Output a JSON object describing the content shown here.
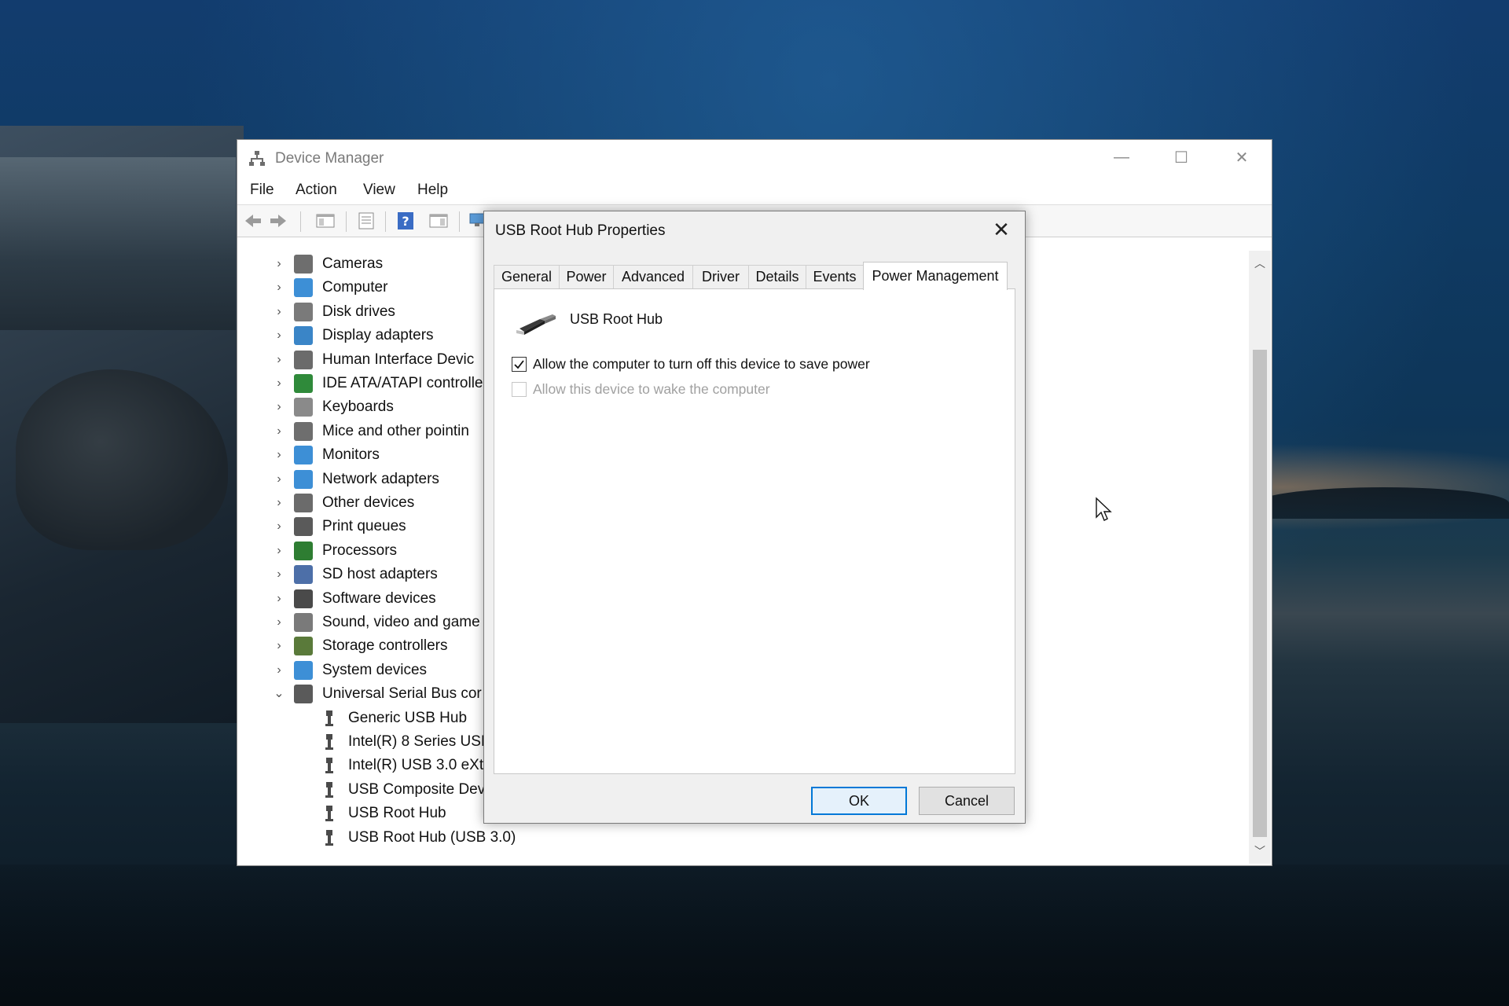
{
  "window": {
    "title": "Device Manager",
    "controls": {
      "minimize": "—",
      "maximize": "☐",
      "close": "✕"
    }
  },
  "menu": [
    "File",
    "Action",
    "View",
    "Help"
  ],
  "tree": {
    "categories": [
      "Cameras",
      "Computer",
      "Disk drives",
      "Display adapters",
      "Human Interface Devic",
      "IDE ATA/ATAPI controlle",
      "Keyboards",
      "Mice and other pointin",
      "Monitors",
      "Network adapters",
      "Other devices",
      "Print queues",
      "Processors",
      "SD host adapters",
      "Software devices",
      "Sound, video and game",
      "Storage controllers",
      "System devices",
      "Universal Serial Bus cor"
    ],
    "usb_children": [
      "Generic USB Hub",
      "Intel(R) 8 Series USB",
      "Intel(R) USB 3.0 eXte",
      "USB Composite Dev",
      "USB Root Hub",
      "USB Root Hub (USB 3.0)"
    ]
  },
  "dialog": {
    "title": "USB Root Hub Properties",
    "close": "✕",
    "tabs": [
      "General",
      "Power",
      "Advanced",
      "Driver",
      "Details",
      "Events",
      "Power Management"
    ],
    "active_tab": "Power Management",
    "device_name": "USB Root Hub",
    "options": [
      {
        "label": "Allow the computer to turn off this device to save power",
        "checked": true,
        "enabled": true
      },
      {
        "label": "Allow this device to wake the computer",
        "checked": false,
        "enabled": false
      }
    ],
    "ok_label": "OK",
    "cancel_label": "Cancel"
  },
  "colors": {
    "accent": "#0078d7",
    "disabled_text": "#a0a0a0"
  }
}
